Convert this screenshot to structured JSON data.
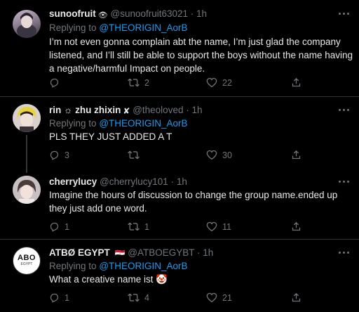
{
  "tweets": [
    {
      "name": "sunoofruit",
      "name_emoji": "👁",
      "handle": "@sunoofruit63021",
      "dot": "·",
      "time": "1h",
      "replying_prefix": "Replying to",
      "replying_to": "@THEORIGIN_AorB",
      "text": "I’m not even gonna complain abt the name, I’m just glad the company listened, and I’ll still be able to support the boys without the name having a negative/harmful Impact on people.",
      "replies": "",
      "retweets": "2",
      "likes": "22"
    },
    {
      "name": "rin ☼ zhu zhixin",
      "name_emoji": "✘",
      "handle": "@theoloved",
      "dot": "·",
      "time": "1h",
      "replying_prefix": "Replying to",
      "replying_to": "@THEORIGIN_AorB",
      "text": "PLS THEY JUST ADDED A T",
      "replies": "3",
      "retweets": "",
      "likes": "30"
    },
    {
      "name": "cherrylucy",
      "handle": "@cherrylucy101",
      "dot": "·",
      "time": "1h",
      "text": "Imagine the hours of discussion to change the group name.ended up they just add one word.",
      "replies": "1",
      "retweets": "1",
      "likes": "11"
    },
    {
      "name": "ATBØ EGYPT",
      "name_emoji": "🇪🇬",
      "handle": "@ATBOEGYBT",
      "dot": "·",
      "time": "1h",
      "replying_prefix": "Replying to",
      "replying_to": "@THEORIGIN_AorB",
      "text": "What a creative name ist 🤡",
      "replies": "1",
      "retweets": "4",
      "likes": "21",
      "avatar_logo": "ABO",
      "avatar_sub": "EGYPT"
    }
  ],
  "colors": {
    "background": "#000000",
    "text": "#e7e9ea",
    "muted": "#71767b",
    "link": "#1d9bf0",
    "separator": "#2f3336"
  }
}
